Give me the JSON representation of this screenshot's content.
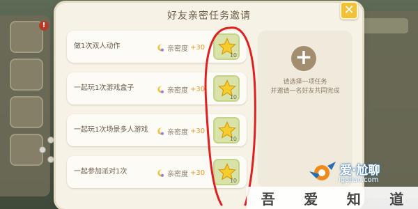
{
  "dialog": {
    "title": "好友亲密任务邀请",
    "close_label": "✕"
  },
  "tasks": [
    {
      "label": "做1次双人动作",
      "intimacy_label": "亲密度",
      "intimacy_value": "+30",
      "reward_count": "10"
    },
    {
      "label": "一起玩1次游戏盒子",
      "intimacy_label": "亲密度",
      "intimacy_value": "+30",
      "reward_count": "10"
    },
    {
      "label": "一起玩1次场景多人游戏",
      "intimacy_label": "亲密度",
      "intimacy_value": "+30",
      "reward_count": "10"
    },
    {
      "label": "一起参加派对1次",
      "intimacy_label": "亲密度",
      "intimacy_value": "+30",
      "reward_count": "10"
    }
  ],
  "add_panel": {
    "plus_label": "+",
    "hint_line1": "请选择一项任务",
    "hint_line2": "并邀请一名好友共同完成"
  },
  "background": {
    "warning_label": "!"
  },
  "watermark": {
    "brand": "爱·尬聊",
    "url": "igaliao.com",
    "bar": [
      "吾",
      "爱",
      "知",
      "道"
    ]
  },
  "colors": {
    "annotation": "#e02020",
    "accent_gold": "#f0c23a",
    "reward_bg": "#d9e3a9"
  },
  "icons": {
    "intimacy": "moon-icon",
    "reward": "star-icon",
    "close": "close-icon",
    "add": "plus-icon"
  }
}
